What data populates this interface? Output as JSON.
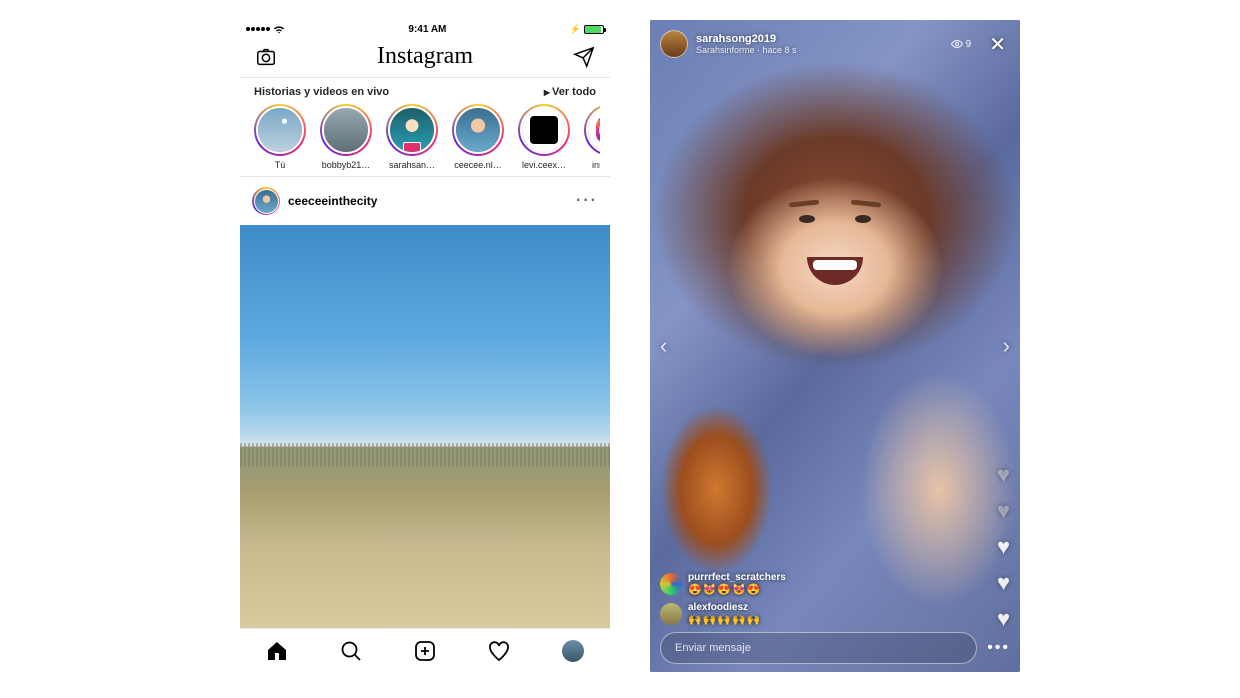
{
  "status": {
    "time": "9:41 AM"
  },
  "topbar": {
    "logo": "Instagram"
  },
  "stories_header": {
    "title": "Historias y videos en vivo",
    "see_all": "Ver todo"
  },
  "stories": [
    {
      "label": "Tú"
    },
    {
      "label": "bobbyb21…"
    },
    {
      "label": "sarahsan…"
    },
    {
      "label": "ceecee.nl…"
    },
    {
      "label": "levi.ceex…"
    },
    {
      "label": "instagr…"
    }
  ],
  "post": {
    "username": "ceeceeinthecity"
  },
  "live": {
    "username": "sarahsong2019",
    "subtitle_prefix": "Sarahsinforme",
    "subtitle_time": "hace 8 s",
    "view_count": "9",
    "comments": [
      {
        "user": "purrrfect_scratchers",
        "body": "😍😻😍😻😍"
      },
      {
        "user": "alexfoodiesz",
        "body": "🙌🙌🙌🙌🙌"
      }
    ],
    "input_placeholder": "Enviar mensaje"
  }
}
